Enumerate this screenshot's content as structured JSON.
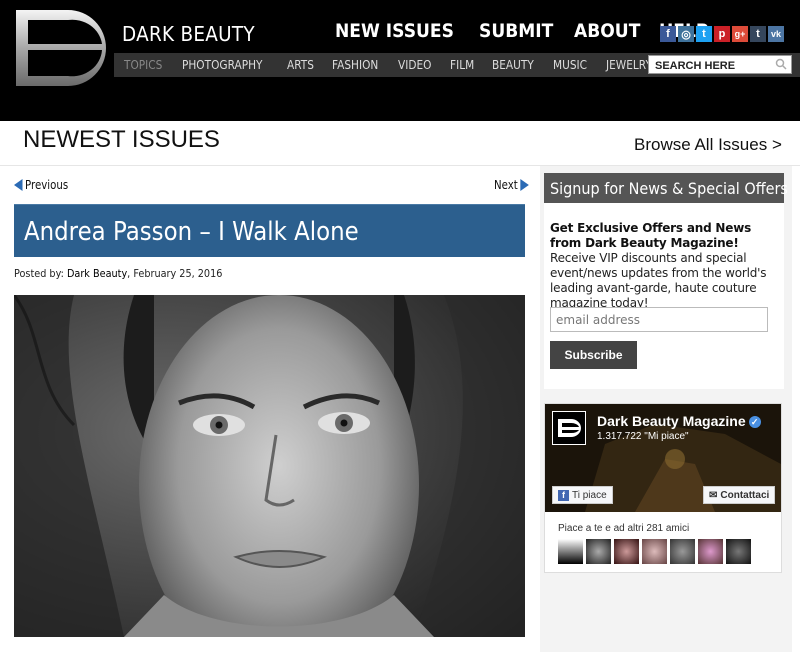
{
  "header": {
    "brand": "DARK BEAUTY",
    "main_nav": [
      "NEW ISSUES",
      "SUBMIT",
      "ABOUT",
      "HELP"
    ],
    "sub_nav": [
      "TOPICS",
      "PHOTOGRAPHY",
      "ARTS",
      "FASHION",
      "VIDEO",
      "FILM",
      "BEAUTY",
      "MUSIC",
      "JEWELRY"
    ],
    "search_placeholder": "SEARCH HERE",
    "social": [
      {
        "icon": "facebook-icon",
        "glyph": "f",
        "color": "#3b5998"
      },
      {
        "icon": "instagram-icon",
        "glyph": "◎",
        "color": "#3f729b"
      },
      {
        "icon": "twitter-icon",
        "glyph": "t",
        "color": "#1da1f2"
      },
      {
        "icon": "pinterest-icon",
        "glyph": "p",
        "color": "#cb2027"
      },
      {
        "icon": "google-plus-icon",
        "glyph": "g+",
        "color": "#dd4b39"
      },
      {
        "icon": "tumblr-icon",
        "glyph": "t",
        "color": "#35465c"
      },
      {
        "icon": "vk-icon",
        "glyph": "vk",
        "color": "#4c75a3"
      }
    ]
  },
  "section": {
    "title": "NEWEST ISSUES",
    "browse_link": "Browse All Issues >"
  },
  "article": {
    "prev_label": "Previous",
    "next_label": "Next",
    "title": "Andrea Passon – I Walk Alone",
    "posted_prefix": "Posted by: ",
    "author": "Dark Beauty",
    "date": ", February 25, 2016"
  },
  "signup": {
    "heading": "Signup for News & Special Offers",
    "bold_text": "Get Exclusive Offers and News from Dark Beauty Magazine!",
    "body_text": " Receive VIP discounts and special event/news updates from the world's leading avant-garde, haute couture magazine today!",
    "email_placeholder": "email address",
    "button_label": "Subscribe"
  },
  "facebook": {
    "page_name": "Dark Beauty Magazine",
    "likes": "1.317.722 \"Mi piace\"",
    "like_button": "Ti piace",
    "contact_button": "Contattaci",
    "friends_text": "Piace a te e ad altri 281 amici"
  },
  "colors": {
    "accent_blue": "#2c5f8e",
    "header_bg": "#000000"
  }
}
